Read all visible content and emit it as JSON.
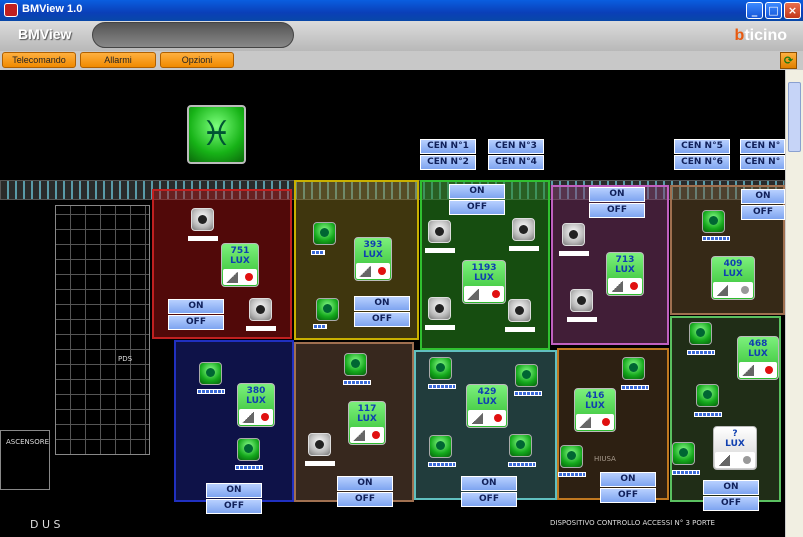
{
  "window": {
    "title": "BMView 1.0"
  },
  "header": {
    "app_name": "BMView",
    "brand": "bticino"
  },
  "tabs": [
    {
      "label": "Telecomando"
    },
    {
      "label": "Allarmi"
    },
    {
      "label": "Opzioni"
    }
  ],
  "canvas": {
    "big_icon_glyph": "♓",
    "cen": [
      "CEN N°1",
      "CEN N°2",
      "CEN N°3",
      "CEN N°4",
      "CEN N°5",
      "CEN N°6",
      "CEN N°",
      "CEN N°"
    ],
    "on_label": "ON",
    "off_label": "OFF",
    "lux": [
      {
        "value": "751",
        "unit": "LUX"
      },
      {
        "value": "393",
        "unit": "LUX"
      },
      {
        "value": "1193",
        "unit": "LUX"
      },
      {
        "value": "713",
        "unit": "LUX"
      },
      {
        "value": "409",
        "unit": "LUX"
      },
      {
        "value": "380",
        "unit": "LUX"
      },
      {
        "value": "117",
        "unit": "LUX"
      },
      {
        "value": "429",
        "unit": "LUX"
      },
      {
        "value": "416",
        "unit": "LUX"
      },
      {
        "value": "468",
        "unit": "LUX"
      },
      {
        "value": "?",
        "unit": "LUX"
      }
    ],
    "plan_labels": {
      "ascensore": "ASCENSORE",
      "dus": "D U S",
      "dispositivo": "DISPOSITIVO CONTROLLO ACCESSI N° 3 PORTE",
      "pds": "PDS",
      "chiusa": "HIUSA"
    }
  },
  "colors": {
    "room_red": "#c02020",
    "room_olive": "#c8b000",
    "room_green": "#30c030",
    "room_purple": "#c060c0",
    "room_orange": "#c07820",
    "room_blue": "#2030c0",
    "room_brown": "#a07050",
    "room_teal": "#60c0c0"
  }
}
